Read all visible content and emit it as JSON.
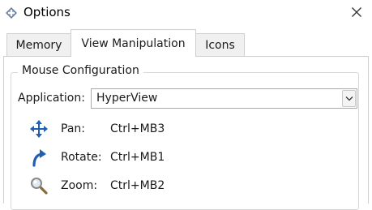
{
  "window": {
    "title": "Options",
    "icon": "options-diamond-icon",
    "close_icon": "close-icon"
  },
  "tabs": [
    {
      "label": "Memory",
      "active": false
    },
    {
      "label": "View Manipulation",
      "active": true
    },
    {
      "label": "Icons",
      "active": false
    }
  ],
  "mouse_config": {
    "group_title": "Mouse Configuration",
    "application_label": "Application:",
    "application_value": "HyperView",
    "rows": [
      {
        "label": "Pan:",
        "value": "Ctrl+MB3",
        "icon": "pan-arrows-icon"
      },
      {
        "label": "Rotate:",
        "value": "Ctrl+MB1",
        "icon": "rotate-arrow-icon"
      },
      {
        "label": "Zoom:",
        "value": "Ctrl+MB2",
        "icon": "magnifier-icon"
      }
    ]
  },
  "colors": {
    "accent": "#1f5fb4",
    "border": "#cfcfcf"
  }
}
